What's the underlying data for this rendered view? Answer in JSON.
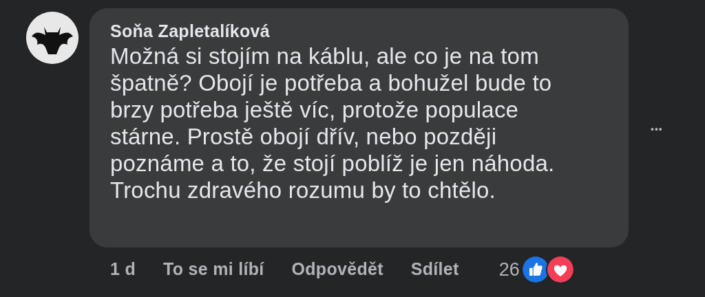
{
  "comment": {
    "author": "Soňa Zapletalíková",
    "text_lines": [
      "Možná si stojím na káblu, ale co je na tom",
      "špatně? Obojí je potřeba a bohužel bude to",
      "brzy potřeba ještě víc, protože populace",
      "stárne. Prostě obojí dřív, nebo později",
      "poznáme a to, že stojí poblíž je jen náhoda.",
      "Trochu zdravého rozumu by to chtělo."
    ],
    "more_button": "•••",
    "time": "1 d",
    "actions": [
      "To se mi líbí",
      "Odpovědět",
      "Sdílet"
    ],
    "reactions": {
      "count": "26",
      "icons": [
        {
          "kind": "like"
        },
        {
          "kind": "love"
        }
      ]
    }
  }
}
